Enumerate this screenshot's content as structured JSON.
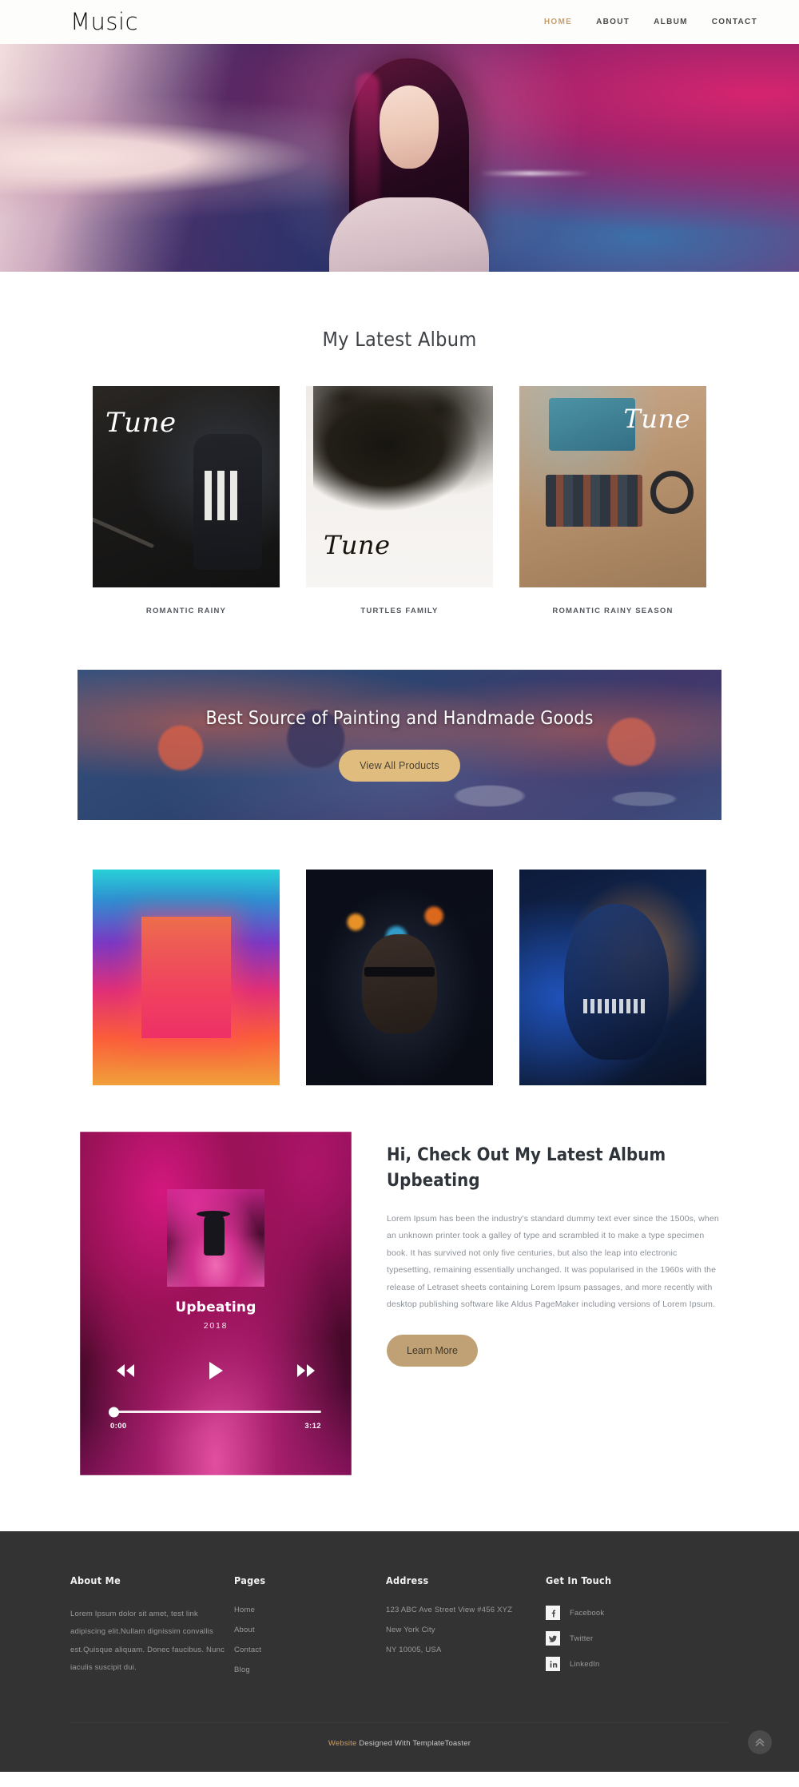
{
  "header": {
    "logo": "Music",
    "nav": [
      {
        "label": "HOME",
        "active": true
      },
      {
        "label": "ABOUT",
        "active": false
      },
      {
        "label": "ALBUM",
        "active": false
      },
      {
        "label": "CONTACT",
        "active": false
      }
    ]
  },
  "albums_section": {
    "title": "My Latest Album",
    "items": [
      {
        "caption": "ROMANTIC RAINY",
        "overlay_text": "Tune"
      },
      {
        "caption": "TURTLES FAMILY",
        "overlay_text": "Tune"
      },
      {
        "caption": "ROMANTIC RAINY SEASON",
        "overlay_text": "Tune"
      }
    ]
  },
  "promo": {
    "title": "Best Source of Painting  and Handmade Goods",
    "button_label": "View All Products"
  },
  "player": {
    "track_title": "Upbeating",
    "year": "2018",
    "time_current": "0:00",
    "time_total": "3:12",
    "progress_percent": 0,
    "prev_icon": "rewind-icon",
    "play_icon": "play-icon",
    "next_icon": "fast-forward-icon"
  },
  "about": {
    "heading_line1": "Hi, Check Out My Latest Album",
    "heading_line2": "Upbeating",
    "body": "Lorem Ipsum has been the industry's standard dummy text ever since the 1500s, when an unknown printer took a galley of type and scrambled it to make a type specimen book. It has survived not only five centuries, but also the leap into electronic typesetting, remaining essentially unchanged. It was popularised in the 1960s with the release of Letraset sheets containing Lorem Ipsum passages, and more recently with desktop publishing software like Aldus PageMaker including versions of Lorem Ipsum.",
    "button_label": "Learn More"
  },
  "footer": {
    "about": {
      "title": "About Me",
      "text": "Lorem Ipsum dolor sit amet, test link adipiscing elit.Nullam dignissim convallis est.Quisque aliquam. Donec faucibus. Nunc iaculis suscipit dui."
    },
    "pages": {
      "title": "Pages",
      "links": [
        "Home",
        "About",
        "Contact",
        "Blog"
      ]
    },
    "address": {
      "title": "Address",
      "lines": [
        "123 ABC Ave Street View #456 XYZ",
        "New York City",
        "NY 10005, USA"
      ]
    },
    "social": {
      "title": "Get In Touch",
      "items": [
        {
          "label": "Facebook",
          "icon": "facebook-icon",
          "glyph": "f"
        },
        {
          "label": "Twitter",
          "icon": "twitter-icon",
          "glyph": "t"
        },
        {
          "label": "LinkedIn",
          "icon": "linkedin-icon",
          "glyph": "in"
        }
      ]
    },
    "bottom": {
      "accent": "Website",
      "rest": " Designed With TemplateToaster"
    },
    "to_top_icon": "double-chevron-up-icon"
  },
  "colors": {
    "accent": "#c79e6e",
    "button": "#c0a175",
    "promo_button": "#e0bd7f",
    "footer_bg": "#333333"
  }
}
